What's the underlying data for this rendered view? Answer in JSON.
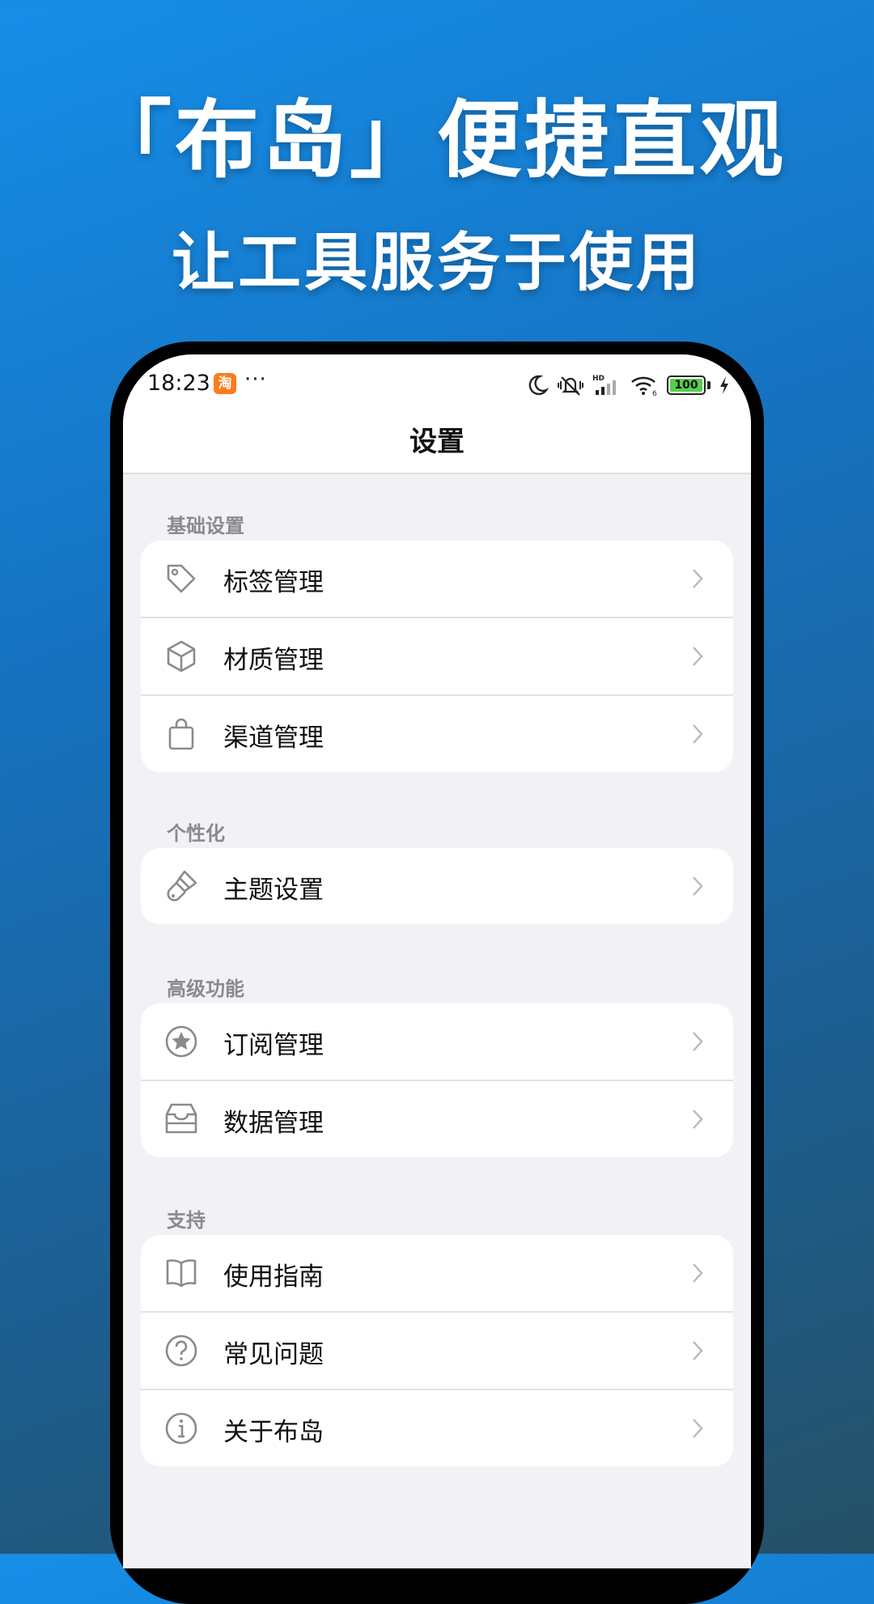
{
  "promo": {
    "headline": "「布岛」便捷直观",
    "subheadline": "让工具服务于使用"
  },
  "status_bar": {
    "time": "18:23",
    "app_badge": "淘",
    "overflow": "···",
    "battery": "100",
    "icons": [
      "moon-icon",
      "mute-vibrate-icon",
      "hd-signal-icon",
      "wifi-icon",
      "battery-icon",
      "charging-icon"
    ]
  },
  "nav": {
    "title": "设置"
  },
  "sections": [
    {
      "title": "基础设置",
      "items": [
        {
          "label": "标签管理",
          "icon": "tag-icon"
        },
        {
          "label": "材质管理",
          "icon": "cube-icon"
        },
        {
          "label": "渠道管理",
          "icon": "bag-icon"
        }
      ]
    },
    {
      "title": "个性化",
      "items": [
        {
          "label": "主题设置",
          "icon": "paintbrush-icon"
        }
      ]
    },
    {
      "title": "高级功能",
      "items": [
        {
          "label": "订阅管理",
          "icon": "star-circle-icon"
        },
        {
          "label": "数据管理",
          "icon": "archive-box-icon"
        }
      ]
    },
    {
      "title": "支持",
      "items": [
        {
          "label": "使用指南",
          "icon": "book-icon"
        },
        {
          "label": "常见问题",
          "icon": "question-circle-icon"
        },
        {
          "label": "关于布岛",
          "icon": "info-circle-icon"
        }
      ]
    }
  ]
}
